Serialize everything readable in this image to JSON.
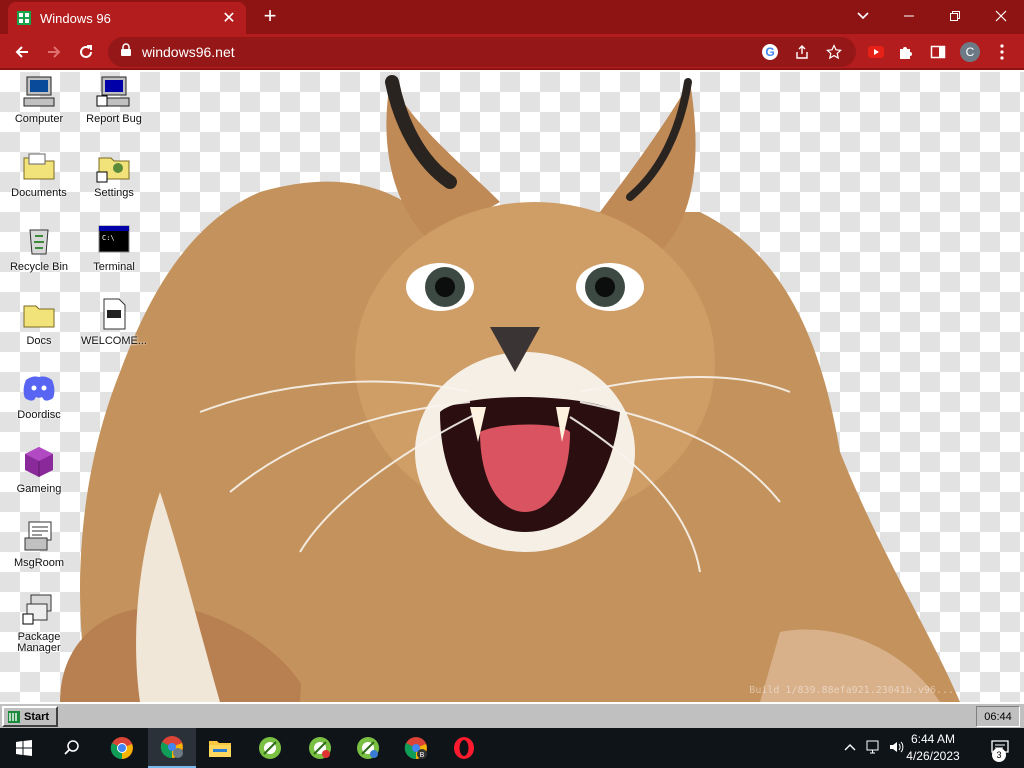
{
  "browser": {
    "tab_title": "Windows 96",
    "url": "windows96.net",
    "profile_initial": "C"
  },
  "desktop": {
    "icons": [
      {
        "name": "computer",
        "label": "Computer"
      },
      {
        "name": "report-bug",
        "label": "Report Bug"
      },
      {
        "name": "documents",
        "label": "Documents"
      },
      {
        "name": "settings",
        "label": "Settings"
      },
      {
        "name": "recycle-bin",
        "label": "Recycle Bin"
      },
      {
        "name": "terminal",
        "label": "Terminal"
      },
      {
        "name": "docs",
        "label": "Docs"
      },
      {
        "name": "welcome",
        "label": "WELCOME..."
      },
      {
        "name": "doordisc",
        "label": "Doordisc"
      },
      {
        "name": "gameing",
        "label": "Gameing"
      },
      {
        "name": "msgroom",
        "label": "MsgRoom"
      },
      {
        "name": "package-manager",
        "label": "Package Manager"
      }
    ],
    "build_watermark": "Build 1/839.88efa921.23041b.v96..."
  },
  "w96_taskbar": {
    "start_label": "Start",
    "clock": "06:44"
  },
  "win_taskbar": {
    "time": "6:44 AM",
    "date": "4/26/2023",
    "notification_count": "3",
    "apps": [
      "search",
      "chrome",
      "chrome-profile",
      "file-explorer",
      "app-green-1",
      "app-green-2",
      "app-green-3",
      "chrome-b",
      "opera"
    ]
  },
  "colors": {
    "browser_theme": "#b41d1d",
    "browser_frame": "#8e1414",
    "w96_face": "#c0c0c0",
    "win_taskbar": "#0f1419"
  }
}
